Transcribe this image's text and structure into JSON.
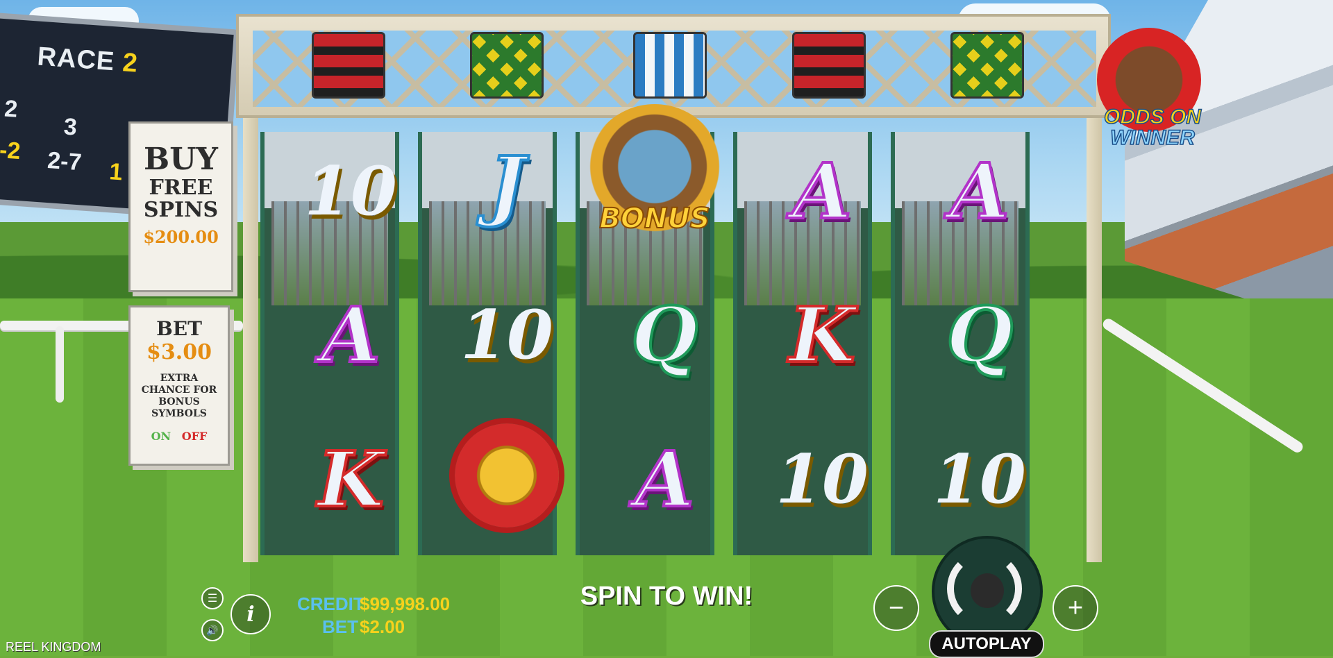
{
  "scoreboard": {
    "race_word": "RACE",
    "race_num": "2",
    "col_labels": [
      "2",
      "3"
    ],
    "odds": [
      "-2",
      "2-7",
      "1"
    ]
  },
  "logo": {
    "line1": "ODDS ON",
    "line2": "WINNER"
  },
  "buy_panel": {
    "title": "BUY",
    "line1": "FREE",
    "line2": "SPINS",
    "price": "$200.00"
  },
  "bet_panel": {
    "title": "BET",
    "amount": "$3.00",
    "desc_line1": "EXTRA",
    "desc_line2": "CHANCE FOR",
    "desc_line3": "BONUS",
    "desc_line4": "SYMBOLS",
    "on": "ON",
    "off": "OFF"
  },
  "silks": [
    "red-black stripes",
    "yellow-green diamonds",
    "blue-white stripes",
    "red-black stripes",
    "yellow-green diamonds"
  ],
  "reels": [
    [
      {
        "label": "10",
        "style": "gold"
      },
      {
        "label": "A",
        "style": "purple"
      },
      {
        "label": "K",
        "style": "red"
      }
    ],
    [
      {
        "label": "J",
        "style": "blue"
      },
      {
        "label": "10",
        "style": "gold"
      },
      {
        "label": "",
        "style": "rosette"
      }
    ],
    [
      {
        "label": "BONUS",
        "style": "bonus"
      },
      {
        "label": "Q",
        "style": "green"
      },
      {
        "label": "A",
        "style": "purple"
      }
    ],
    [
      {
        "label": "A",
        "style": "purple"
      },
      {
        "label": "K",
        "style": "red"
      },
      {
        "label": "10",
        "style": "gold"
      }
    ],
    [
      {
        "label": "A",
        "style": "purple"
      },
      {
        "label": "Q",
        "style": "green"
      },
      {
        "label": "10",
        "style": "gold"
      }
    ]
  ],
  "bottom": {
    "credit_label": "CREDIT",
    "credit_value": "$99,998.00",
    "bet_label": "BET",
    "bet_value": "$2.00",
    "message": "SPIN TO WIN!",
    "autoplay": "AUTOPLAY",
    "info": "i",
    "minus": "−",
    "plus": "+",
    "brand": "REEL KINGDOM"
  }
}
